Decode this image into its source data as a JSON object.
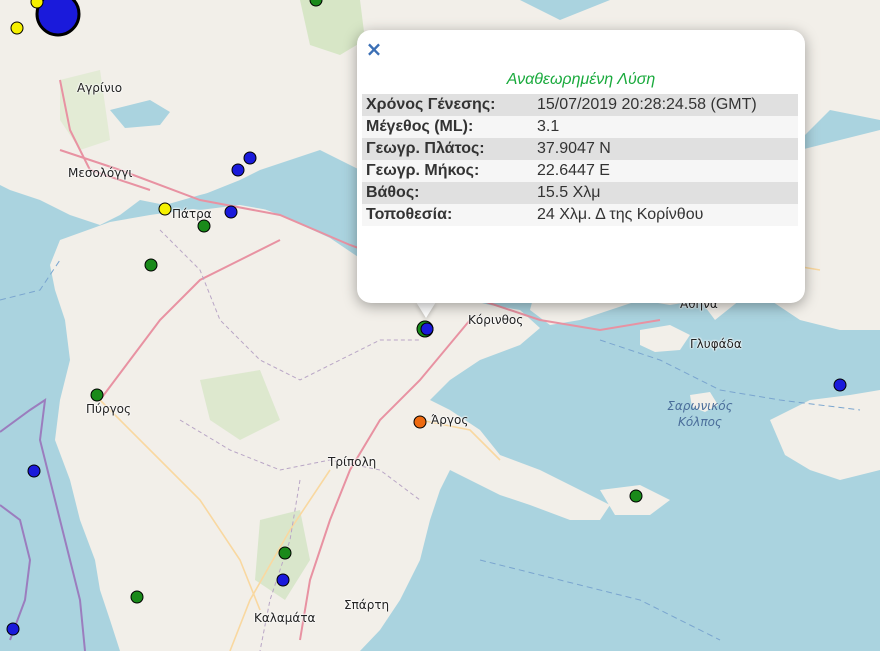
{
  "map": {
    "places": [
      {
        "id": "agrinio",
        "name": "Αγρίνιο"
      },
      {
        "id": "mesolongi",
        "name": "Μεσολόγγι"
      },
      {
        "id": "patra",
        "name": "Πάτρα"
      },
      {
        "id": "korinthos",
        "name": "Κόρινθος"
      },
      {
        "id": "athina",
        "name": "Αθήνα"
      },
      {
        "id": "glyfada",
        "name": "Γλυφάδα"
      },
      {
        "id": "pyrgos",
        "name": "Πύργος"
      },
      {
        "id": "argos",
        "name": "Άργος"
      },
      {
        "id": "tripoli",
        "name": "Τρίπολη"
      },
      {
        "id": "kalamata",
        "name": "Καλαμάτα"
      },
      {
        "id": "sparti",
        "name": "Σπάρτη"
      }
    ],
    "sea_label": {
      "line1": "Σαρωνικός",
      "line2": "Κόλπος"
    },
    "marker_colors": {
      "blue": "#1a1adb",
      "green": "#1a8a1a",
      "yellow": "#f5f000",
      "orange": "#ee6a10"
    }
  },
  "popup": {
    "close_symbol": "×",
    "title": "Αναθεωρημένη Λύση",
    "title_color": "#1aaa3d",
    "rows": [
      {
        "label": "Χρόνος Γένεσης:",
        "value": "15/07/2019 20:28:24.58 (GMT)"
      },
      {
        "label": "Μέγεθος (ML):",
        "value": "3.1"
      },
      {
        "label": "Γεωγρ. Πλάτος:",
        "value": "37.9047 N"
      },
      {
        "label": "Γεωγρ. Μήκος:",
        "value": "22.6447 E"
      },
      {
        "label": "Βάθος:",
        "value": "15.5 Χλμ"
      },
      {
        "label": "Τοποθεσία:",
        "value": "24 Χλμ. Δ της Κορίνθου"
      }
    ]
  }
}
